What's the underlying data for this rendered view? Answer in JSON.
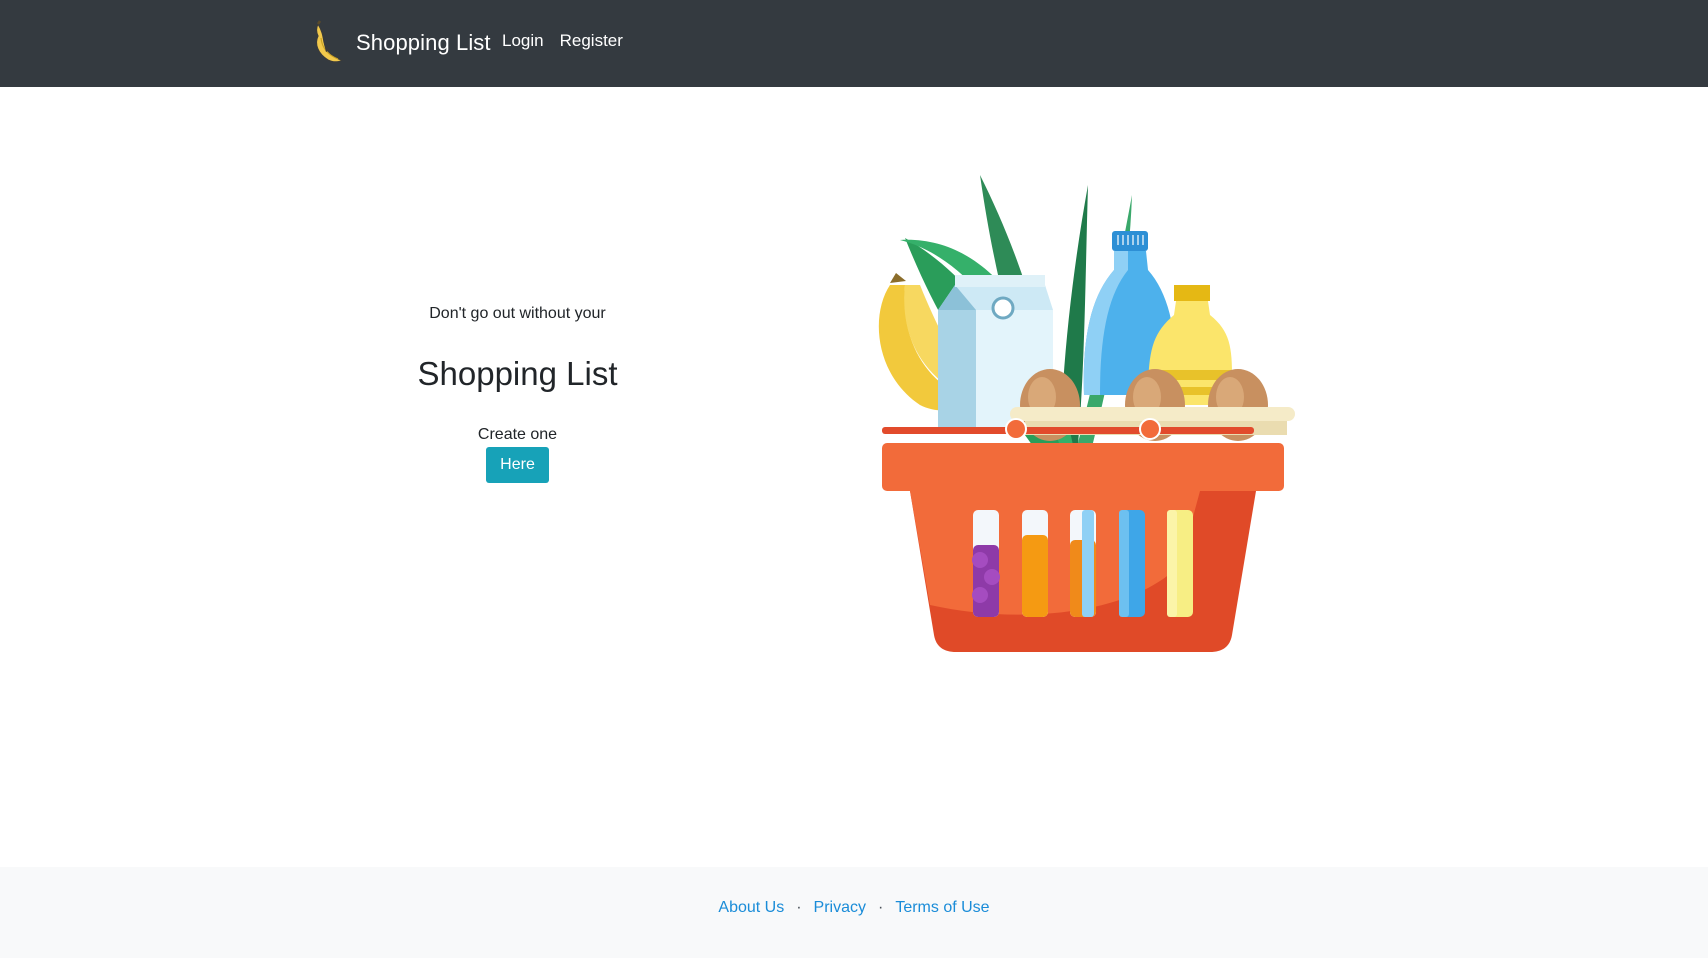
{
  "navbar": {
    "brand": "Shopping List",
    "brand_icon": "banana-icon",
    "links": [
      "Login",
      "Register"
    ]
  },
  "hero": {
    "tagline": "Don't go out without your",
    "title": "Shopping List",
    "create_text": "Create one",
    "button_label": "Here",
    "button_color": "#17a2b8"
  },
  "illustration": {
    "icon": "grocery-basket-illustration"
  },
  "footer": {
    "links": [
      "About Us",
      "Privacy",
      "Terms of Use"
    ],
    "separator": "·",
    "link_color": "#1a8cd8"
  },
  "colors": {
    "navbar_bg": "#343a40",
    "footer_bg": "#f8f9fa"
  }
}
